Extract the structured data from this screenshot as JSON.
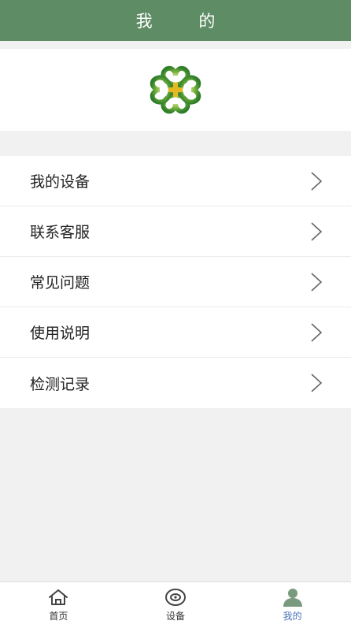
{
  "header": {
    "title": "我 的"
  },
  "banner": {
    "logo_icon": "clover-cross-logo",
    "logo_color": "#3f8a2c"
  },
  "menu": {
    "items": [
      {
        "label": "我的设备",
        "icon": "chevron-right-icon"
      },
      {
        "label": "联系客服",
        "icon": "chevron-right-icon"
      },
      {
        "label": "常见问题",
        "icon": "chevron-right-icon"
      },
      {
        "label": "使用说明",
        "icon": "chevron-right-icon"
      },
      {
        "label": "检测记录",
        "icon": "chevron-right-icon"
      }
    ]
  },
  "tabbar": {
    "tabs": [
      {
        "label": "首页",
        "icon": "home-icon",
        "active": false
      },
      {
        "label": "设备",
        "icon": "eye-device-icon",
        "active": false
      },
      {
        "label": "我的",
        "icon": "person-icon",
        "active": true
      }
    ],
    "active_color": "#4b74b8"
  },
  "colors": {
    "header_bg": "#5e8c64",
    "page_bg": "#f1f1f1"
  }
}
